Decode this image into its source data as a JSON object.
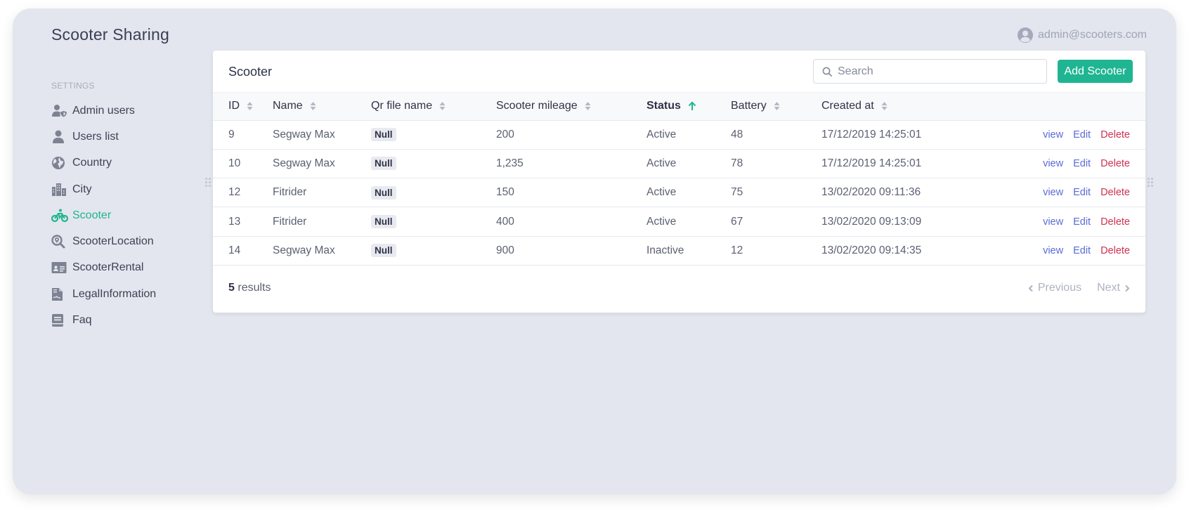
{
  "app": {
    "title": "Scooter Sharing"
  },
  "user": {
    "email": "admin@scooters.com",
    "icon": "user-circle-icon"
  },
  "sidebar": {
    "section_label": "SETTINGS",
    "items": [
      {
        "label": "Admin users",
        "icon": "admin-users-icon",
        "active": false
      },
      {
        "label": "Users list",
        "icon": "user-icon",
        "active": false
      },
      {
        "label": "Country",
        "icon": "globe-icon",
        "active": false
      },
      {
        "label": "City",
        "icon": "city-icon",
        "active": false
      },
      {
        "label": "Scooter",
        "icon": "bicycle-icon",
        "active": true
      },
      {
        "label": "ScooterLocation",
        "icon": "search-location-icon",
        "active": false
      },
      {
        "label": "ScooterRental",
        "icon": "id-card-icon",
        "active": false
      },
      {
        "label": "LegalInformation",
        "icon": "file-contract-icon",
        "active": false
      },
      {
        "label": "Faq",
        "icon": "book-icon",
        "active": false
      }
    ]
  },
  "main": {
    "title": "Scooter",
    "search": {
      "placeholder": "Search",
      "value": ""
    },
    "add_button": "Add Scooter",
    "columns": [
      {
        "label": "ID",
        "sort": "none"
      },
      {
        "label": "Name",
        "sort": "none"
      },
      {
        "label": "Qr file name",
        "sort": "none"
      },
      {
        "label": "Scooter mileage",
        "sort": "none"
      },
      {
        "label": "Status",
        "sort": "asc"
      },
      {
        "label": "Battery",
        "sort": "none"
      },
      {
        "label": "Created at",
        "sort": "none"
      }
    ],
    "rows": [
      {
        "id": "9",
        "name": "Segway Max",
        "qr": "Null",
        "mileage": "200",
        "status": "Active",
        "battery": "48",
        "created": "17/12/2019 14:25:01"
      },
      {
        "id": "10",
        "name": "Segway Max",
        "qr": "Null",
        "mileage": "1,235",
        "status": "Active",
        "battery": "78",
        "created": "17/12/2019 14:25:01"
      },
      {
        "id": "12",
        "name": "Fitrider",
        "qr": "Null",
        "mileage": "150",
        "status": "Active",
        "battery": "75",
        "created": "13/02/2020 09:11:36"
      },
      {
        "id": "13",
        "name": "Fitrider",
        "qr": "Null",
        "mileage": "400",
        "status": "Active",
        "battery": "67",
        "created": "13/02/2020 09:13:09"
      },
      {
        "id": "14",
        "name": "Segway Max",
        "qr": "Null",
        "mileage": "900",
        "status": "Inactive",
        "battery": "12",
        "created": "13/02/2020 09:14:35"
      }
    ],
    "row_actions": {
      "view": "view",
      "edit": "Edit",
      "delete": "Delete"
    },
    "footer": {
      "count": "5",
      "results_label": "results",
      "previous": "Previous",
      "next": "Next"
    }
  },
  "colors": {
    "accent": "#1fb592",
    "link": "#5b6bd6",
    "danger": "#cf3150",
    "background": "#e3e6ee"
  }
}
